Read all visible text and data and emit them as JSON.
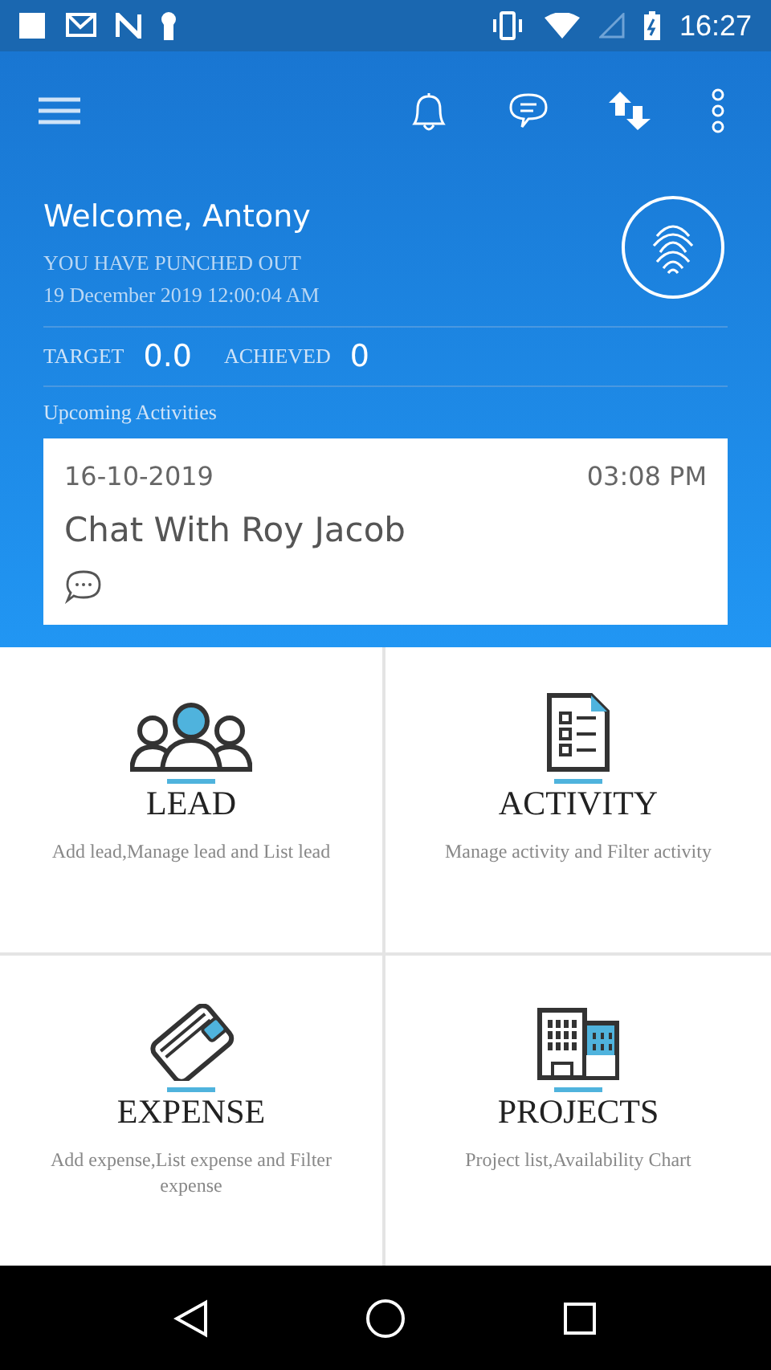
{
  "status_bar": {
    "time": "16:27"
  },
  "welcome": {
    "greeting": "Welcome, Antony",
    "punch_status": "YOU HAVE PUNCHED OUT",
    "punch_time": "19 December 2019 12:00:04 AM"
  },
  "stats": [
    {
      "label": "TARGET",
      "value": "0.0"
    },
    {
      "label": "ACHIEVED",
      "value": "0"
    }
  ],
  "upcoming": {
    "heading": "Upcoming Activities",
    "activities": [
      {
        "date": "16-10-2019",
        "time": "03:08 PM",
        "title": "Chat With Roy Jacob"
      }
    ]
  },
  "modules": [
    {
      "kind": "lead",
      "title": "LEAD",
      "description": "Add lead,Manage lead and List lead"
    },
    {
      "kind": "activity",
      "title": "ACTIVITY",
      "description": "Manage activity and Filter activity"
    },
    {
      "kind": "expense",
      "title": "EXPENSE",
      "description": "Add expense,List expense and Filter expense"
    },
    {
      "kind": "projects",
      "title": "PROJECTS",
      "description": "Project list,Availability Chart"
    }
  ]
}
